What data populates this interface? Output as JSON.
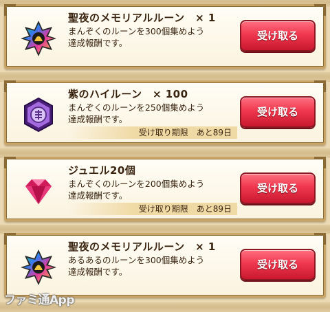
{
  "rewards": [
    {
      "icon": "memorial-rune-star-icon",
      "title": "聖夜のメモリアルルーン　× 1",
      "desc_line1": "まんぞくのルーンを300個集めよう",
      "desc_line2": "達成報酬です。",
      "deadline": "",
      "button": "受け取る"
    },
    {
      "icon": "purple-high-rune-icon",
      "title": "紫のハイルーン　× 100",
      "desc_line1": "まんぞくのルーンを250個集めよう",
      "desc_line2": "達成報酬です。",
      "deadline": "受け取り期限　あと89日",
      "button": "受け取る"
    },
    {
      "icon": "jewel-gem-icon",
      "title": "ジュエル20個",
      "desc_line1": "まんぞくのルーンを200個集めよう",
      "desc_line2": "達成報酬です。",
      "deadline": "受け取り期限　あと89日",
      "button": "受け取る"
    },
    {
      "icon": "memorial-rune-star-icon",
      "title": "聖夜のメモリアルルーン　× 1",
      "desc_line1": "あるあるのルーンを300個集めよう",
      "desc_line2": "達成報酬です。",
      "deadline": "",
      "button": "受け取る"
    }
  ],
  "watermark": "ファミ通App",
  "colors": {
    "button": "#f0384f",
    "frame": "#c9a567",
    "text": "#3a2410"
  }
}
